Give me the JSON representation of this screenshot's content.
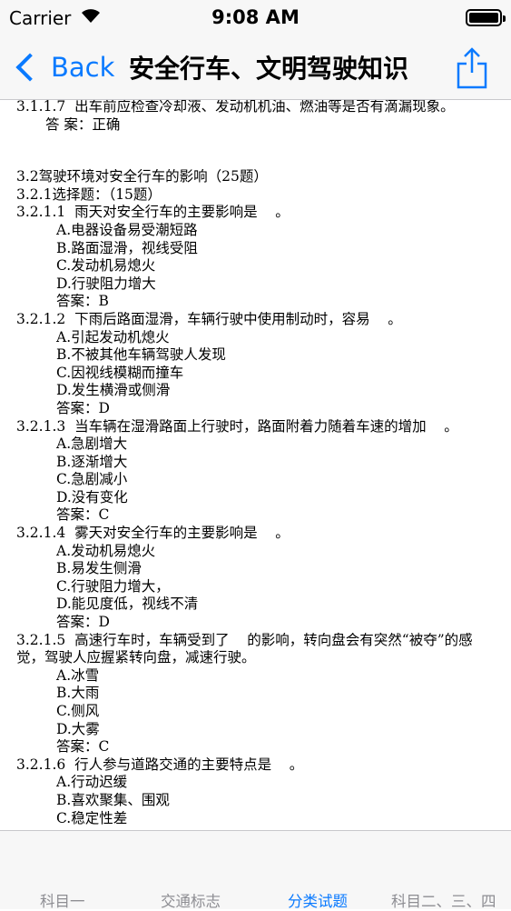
{
  "status_bar": {
    "carrier": "Carrier",
    "time": "9:08 AM"
  },
  "nav": {
    "back_label": "Back",
    "title": "安全行车、文明驾驶知识"
  },
  "content": {
    "lines": [
      "3.1.1.7  出车前应检查冷却液、发动机机油、燃油等是否有滴漏现象。",
      "答 案：正确",
      "3.2驾驶环境对安全行车的影响（25题）",
      "3.2.1选择题：（15题）",
      "3.2.1.1  雨天对安全行车的主要影响是    。",
      "A.电器设备易受潮短路",
      "B.路面湿滑，视线受阻",
      "C.发动机易熄火",
      "D.行驶阻力增大",
      "答案：B",
      "3.2.1.2  下雨后路面湿滑，车辆行驶中使用制动时，容易    。",
      "A.引起发动机熄火",
      "B.不被其他车辆驾驶人发现",
      "C.因视线模糊而撞车",
      "D.发生横滑或侧滑",
      "答案：D",
      "3.2.1.3  当车辆在湿滑路面上行驶时，路面附着力随着车速的增加    。",
      "A.急剧增大",
      "B.逐渐增大",
      "C.急剧减小",
      "D.没有变化",
      "答案：C",
      "3.2.1.4  雾天对安全行车的主要影响是    。",
      "A.发动机易熄火",
      "B.易发生侧滑",
      "C.行驶阻力增大，",
      "D.能见度低，视线不清",
      "答案：D",
      "3.2.1.5  高速行车时，车辆受到了    的影响，转向盘会有突然“被夺”的感",
      "觉，驾驶人应握紧转向盘，减速行驶。",
      "A.冰雪",
      "B.大雨",
      "C.侧风",
      "D.大雾",
      "答案：C",
      "3.2.1.6  行人参与道路交通的主要特点是    。",
      "A.行动迟缓",
      "B.喜欢聚集、围观",
      "C.稳定性差"
    ]
  },
  "tabbar": {
    "tabs": [
      "科目一",
      "交通标志",
      "分类试题",
      "科目二、三、四"
    ]
  },
  "colors": {
    "accent": "#0a7aff",
    "inactive": "#8e8e93",
    "bar_bg": "#f7f7f7"
  }
}
